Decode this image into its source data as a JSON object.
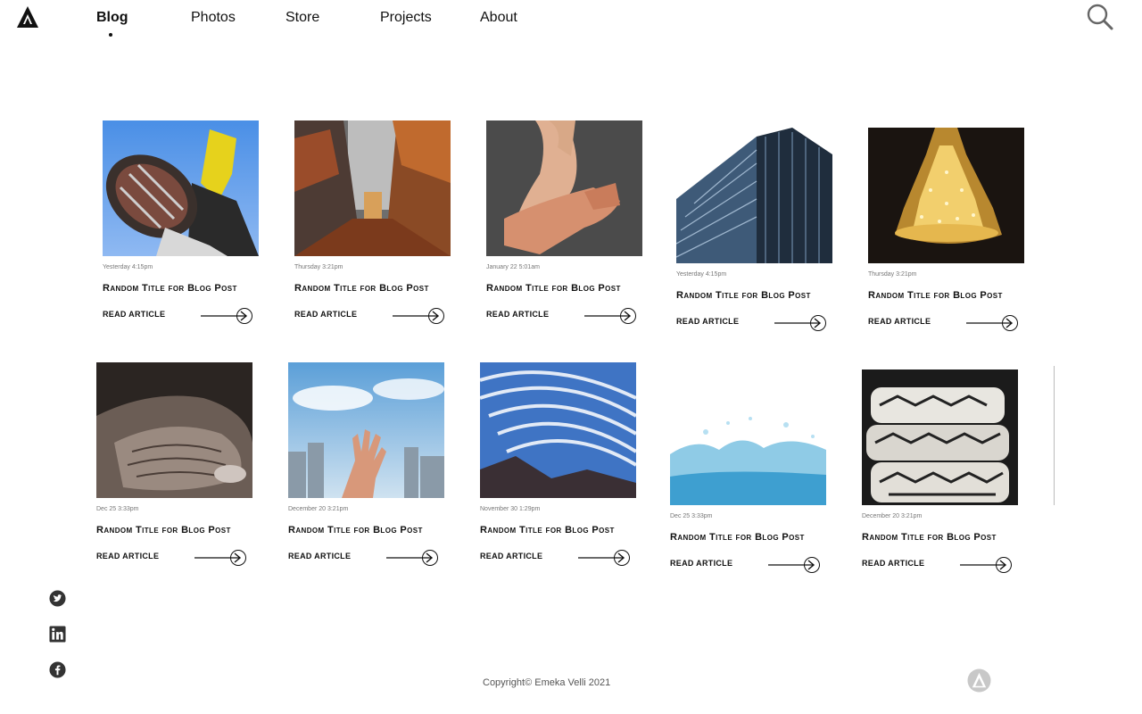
{
  "nav": {
    "items": [
      {
        "label": "Blog",
        "active": true
      },
      {
        "label": "Photos",
        "active": false
      },
      {
        "label": "Store",
        "active": false
      },
      {
        "label": "Projects",
        "active": false
      },
      {
        "label": "About",
        "active": false
      }
    ]
  },
  "icons": {
    "logo": "triangle-a-logo-icon",
    "search": "search-icon",
    "twitter": "twitter-icon",
    "linkedin": "linkedin-icon",
    "facebook": "facebook-icon",
    "back_to_top": "arrow-up-icon"
  },
  "posts": [
    {
      "date": "Yesterday 4:15pm",
      "title": "Random Title for Blog Post",
      "cta": "READ ARTICLE",
      "image": "sneaker-sole"
    },
    {
      "date": "Thursday 3:21pm",
      "title": "Random Title for Blog Post",
      "cta": "READ ARTICLE",
      "image": "autumn-forest"
    },
    {
      "date": "January 22 5:01am",
      "title": "Random Title for Blog Post",
      "cta": "READ ARTICLE",
      "image": "contortion-hand"
    },
    {
      "date": "Yesterday 4:15pm",
      "title": "Random Title for Blog Post",
      "cta": "READ ARTICLE",
      "image": "skyscraper"
    },
    {
      "date": "Thursday 3:21pm",
      "title": "Random Title for Blog Post",
      "cta": "READ ARTICLE",
      "image": "chandelier"
    },
    {
      "date": "Dec 25 3:33pm",
      "title": "Random Title for Blog Post",
      "cta": "READ ARTICLE",
      "image": "old-hands"
    },
    {
      "date": "December 20 3:21pm",
      "title": "Random Title for Blog Post",
      "cta": "READ ARTICLE",
      "image": "hand-sky-city"
    },
    {
      "date": "November 30 1:29pm",
      "title": "Random Title for Blog Post",
      "cta": "READ ARTICLE",
      "image": "cloud-streaks"
    },
    {
      "date": "Dec 25 3:33pm",
      "title": "Random Title for Blog Post",
      "cta": "READ ARTICLE",
      "image": "water-splash"
    },
    {
      "date": "December 20 3:21pm",
      "title": "Random Title for Blog Post",
      "cta": "READ ARTICLE",
      "image": "patterned-blankets"
    }
  ],
  "footer": {
    "copyright": "Copyright© Emeka Velli 2021"
  }
}
